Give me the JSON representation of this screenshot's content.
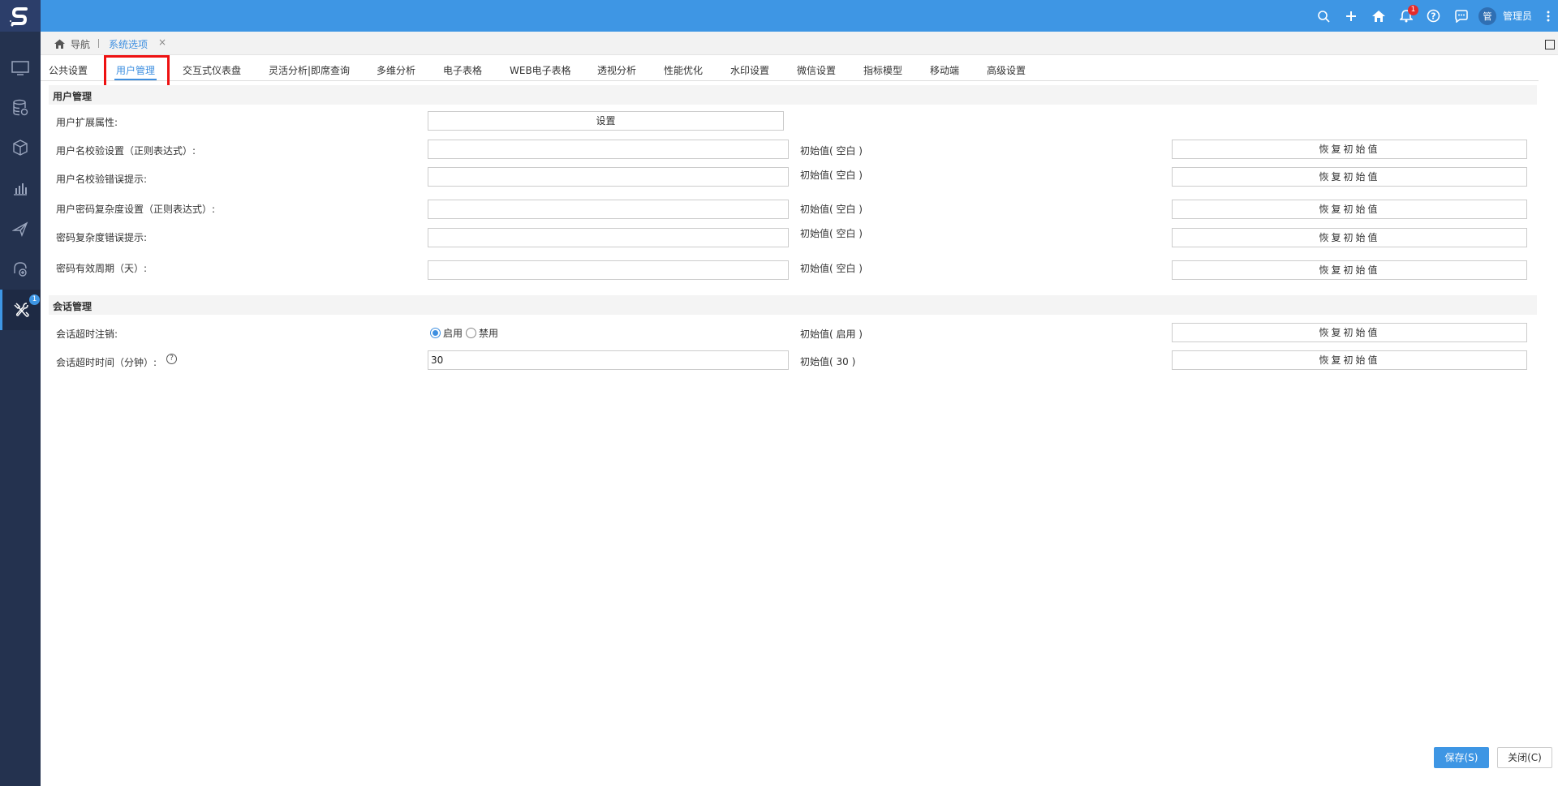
{
  "topbar": {
    "notification_count": "1",
    "user_avatar": "管",
    "user_name": "管理员",
    "icons": [
      "search-icon",
      "plus-icon",
      "home-icon",
      "bell-icon",
      "help-icon",
      "chat-icon",
      "more-icon"
    ]
  },
  "sidebar": {
    "items": [
      "monitor-icon",
      "database-icon",
      "cube-icon",
      "chart-icon",
      "send-icon",
      "analysis-icon",
      "tools-icon"
    ],
    "tools_badge": "1"
  },
  "breadcrumb": {
    "home_label": "导航",
    "tab_label": "系统选项",
    "close": "×"
  },
  "tabs": [
    "公共设置",
    "用户管理",
    "交互式仪表盘",
    "灵活分析|即席查询",
    "多维分析",
    "电子表格",
    "WEB电子表格",
    "透视分析",
    "性能优化",
    "水印设置",
    "微信设置",
    "指标模型",
    "移动端",
    "高级设置"
  ],
  "active_tab": "用户管理",
  "user_section": {
    "title": "用户管理",
    "ext_label": "用户扩展属性:",
    "ext_button": "设置",
    "rows": [
      {
        "label": "用户名校验设置（正则表达式）:",
        "value": "",
        "initial": "初始值( 空白 )",
        "reset": "恢复初始值"
      },
      {
        "label": "用户名校验错误提示:",
        "value": "",
        "initial": "初始值( 空白 )",
        "reset": "恢复初始值"
      },
      {
        "label": "用户密码复杂度设置（正则表达式）:",
        "value": "",
        "initial": "初始值( 空白 )",
        "reset": "恢复初始值"
      },
      {
        "label": "密码复杂度错误提示:",
        "value": "",
        "initial": "初始值( 空白 )",
        "reset": "恢复初始值"
      },
      {
        "label": "密码有效周期（天）:",
        "value": "",
        "initial": "初始值( 空白 )",
        "reset": "恢复初始值"
      }
    ]
  },
  "session_section": {
    "title": "会话管理",
    "timeout_logout": {
      "label": "会话超时注销:",
      "option_enable": "启用",
      "option_disable": "禁用",
      "selected": "启用",
      "initial": "初始值( 启用 )",
      "reset": "恢复初始值"
    },
    "timeout_minutes": {
      "label": "会话超时时间（分钟）:",
      "value": "30",
      "initial": "初始值( 30 )",
      "reset": "恢复初始值"
    }
  },
  "footer": {
    "save": "保存(S)",
    "close": "关闭(C)"
  }
}
